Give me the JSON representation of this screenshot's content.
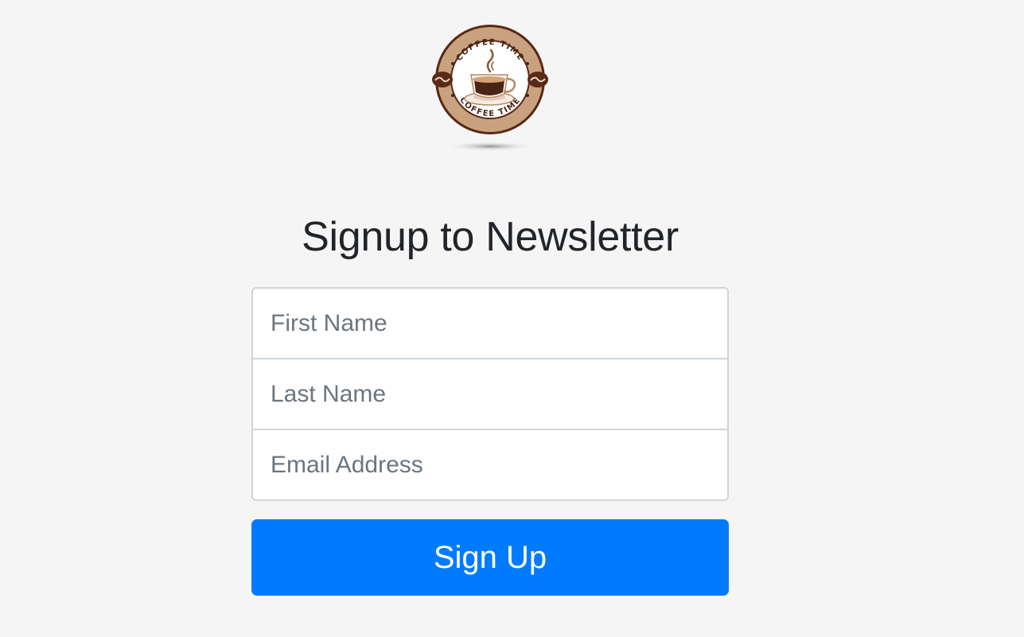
{
  "logo": {
    "text_top": "COFFEE TIME",
    "text_bottom": "COFFEE TIME",
    "colors": {
      "ring_dark": "#5a2716",
      "ring_tan": "#c8a27e",
      "cup_coffee": "#4a2414",
      "beans": "#5a2a16"
    }
  },
  "heading": "Signup to Newsletter",
  "form": {
    "first_name": {
      "placeholder": "First Name",
      "value": ""
    },
    "last_name": {
      "placeholder": "Last Name",
      "value": ""
    },
    "email": {
      "placeholder": "Email Address",
      "value": ""
    }
  },
  "submit_label": "Sign Up",
  "colors": {
    "background": "#f5f5f5",
    "button": "#007bff",
    "input_border": "#ced4da",
    "placeholder": "#6c757d",
    "heading": "#212529"
  }
}
